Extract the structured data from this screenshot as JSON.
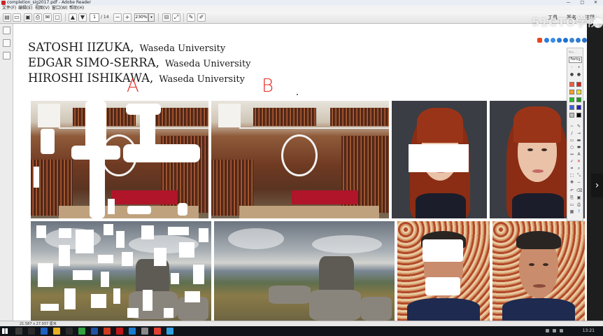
{
  "window": {
    "title": "completion_sig2017.pdf - Adobe Reader",
    "controls": "— □ ✕"
  },
  "menu": [
    "文件(F)",
    "编辑(E)",
    "视图(V)",
    "窗口(W)",
    "帮助(H)"
  ],
  "toolbar": {
    "page_current": "1",
    "page_total": "/ 14",
    "zoom": "230%",
    "zoom_drop": "▾",
    "tools_label": "工具",
    "sign_label": "签名",
    "comment_label": "注释"
  },
  "watermark": {
    "text": "51CTO学院"
  },
  "document": {
    "authors": [
      {
        "name": "SATOSHI IIZUKA,",
        "affiliation": "Waseda University"
      },
      {
        "name": "EDGAR SIMO-SERRA,",
        "affiliation": "Waseda University"
      },
      {
        "name": "HIROSHI ISHIKAWA,",
        "affiliation": "Waseda University"
      }
    ],
    "annotations": [
      "A",
      "B"
    ]
  },
  "palette": {
    "label": "Pen...",
    "button": "Fertig",
    "colors": [
      "#ff5a3c",
      "#e02020",
      "#ffa020",
      "#f0e020",
      "#20c020",
      "#10a010",
      "#4060e0",
      "#2020c0",
      "#c0c0c0",
      "#000000"
    ]
  },
  "status": {
    "dimensions": "21.587 x 27.937 厘米"
  },
  "taskbar": {
    "time": "13:21"
  }
}
